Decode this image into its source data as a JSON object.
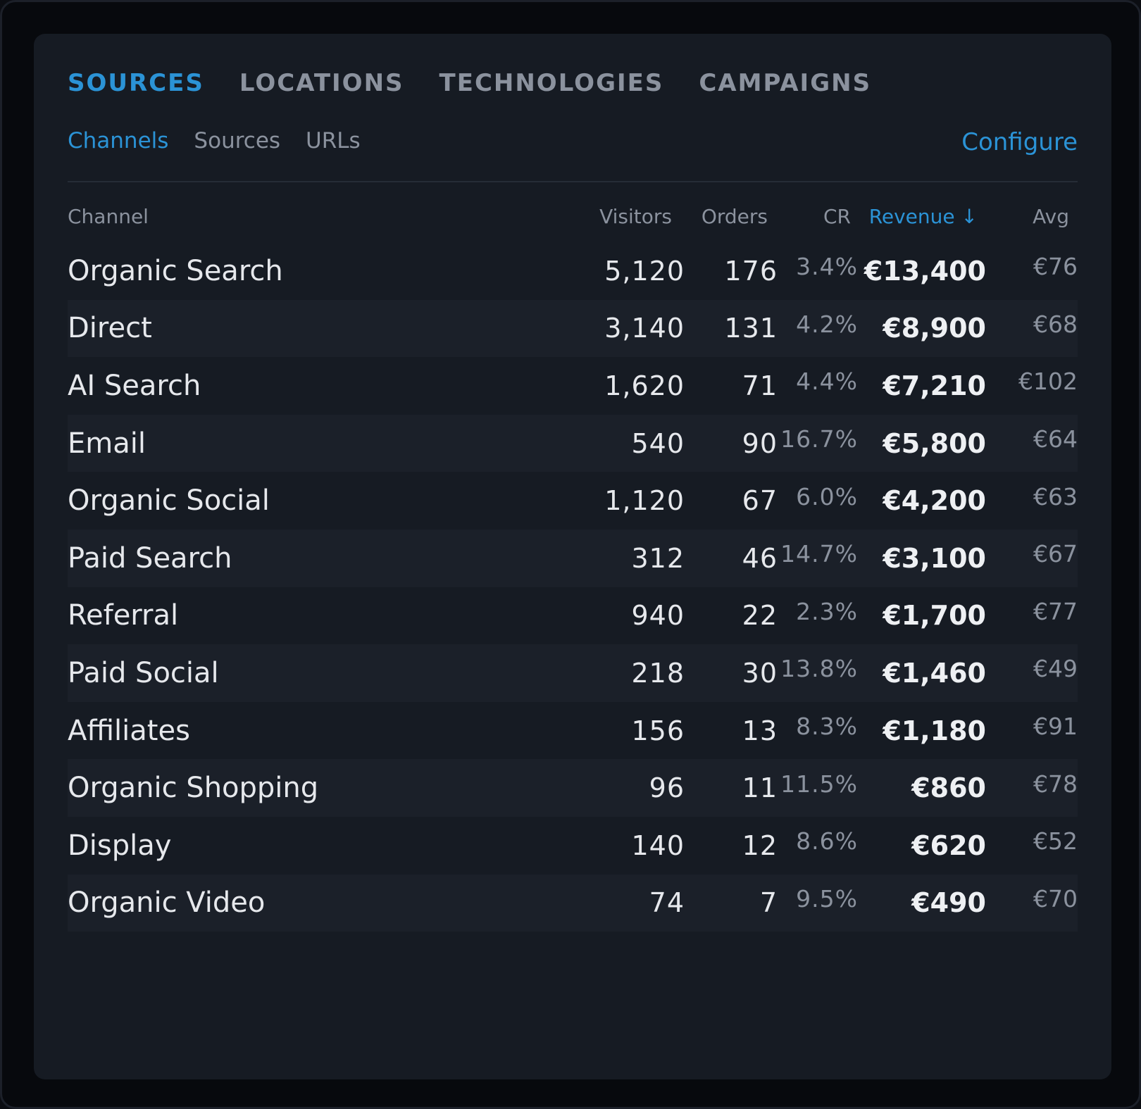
{
  "tabs": [
    "SOURCES",
    "LOCATIONS",
    "TECHNOLOGIES",
    "CAMPAIGNS"
  ],
  "subtabs": [
    "Channels",
    "Sources",
    "URLs"
  ],
  "configure_label": "Configure",
  "columns": {
    "channel": "Channel",
    "visitors": "Visitors",
    "orders": "Orders",
    "cr": "CR",
    "revenue": "Revenue ↓",
    "avg": "Avg"
  },
  "rows": [
    {
      "name": "Organic Search",
      "visitors": "5,120",
      "orders": "176",
      "cr": "3.4%",
      "revenue": "€13,400",
      "avg": "€76"
    },
    {
      "name": "Direct",
      "visitors": "3,140",
      "orders": "131",
      "cr": "4.2%",
      "revenue": "€8,900",
      "avg": "€68"
    },
    {
      "name": "AI Search",
      "visitors": "1,620",
      "orders": "71",
      "cr": "4.4%",
      "revenue": "€7,210",
      "avg": "€102"
    },
    {
      "name": "Email",
      "visitors": "540",
      "orders": "90",
      "cr": "16.7%",
      "revenue": "€5,800",
      "avg": "€64"
    },
    {
      "name": "Organic Social",
      "visitors": "1,120",
      "orders": "67",
      "cr": "6.0%",
      "revenue": "€4,200",
      "avg": "€63"
    },
    {
      "name": "Paid Search",
      "visitors": "312",
      "orders": "46",
      "cr": "14.7%",
      "revenue": "€3,100",
      "avg": "€67"
    },
    {
      "name": "Referral",
      "visitors": "940",
      "orders": "22",
      "cr": "2.3%",
      "revenue": "€1,700",
      "avg": "€77"
    },
    {
      "name": "Paid Social",
      "visitors": "218",
      "orders": "30",
      "cr": "13.8%",
      "revenue": "€1,460",
      "avg": "€49"
    },
    {
      "name": "Affiliates",
      "visitors": "156",
      "orders": "13",
      "cr": "8.3%",
      "revenue": "€1,180",
      "avg": "€91"
    },
    {
      "name": "Organic Shopping",
      "visitors": "96",
      "orders": "11",
      "cr": "11.5%",
      "revenue": "€860",
      "avg": "€78"
    },
    {
      "name": "Display",
      "visitors": "140",
      "orders": "12",
      "cr": "8.6%",
      "revenue": "€620",
      "avg": "€52"
    },
    {
      "name": "Organic Video",
      "visitors": "74",
      "orders": "7",
      "cr": "9.5%",
      "revenue": "€490",
      "avg": "€70"
    }
  ],
  "colors": {
    "accent": "#2b93d6",
    "card_bg": "#161b23",
    "stripe_bg": "#1b2029",
    "muted_text": "#8b929e",
    "primary_text": "#e6e8ec"
  }
}
